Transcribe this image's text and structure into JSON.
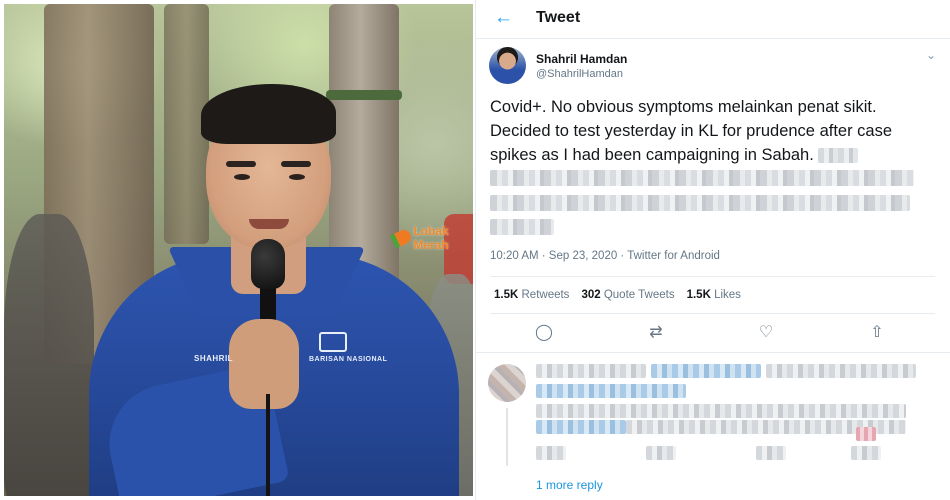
{
  "header": {
    "back_icon": "arrow-left-icon",
    "title": "Tweet"
  },
  "watermark": {
    "text": "Lobak Merah"
  },
  "photo": {
    "shirt_name": "SHAHRIL",
    "shirt_party": "BARISAN NASIONAL"
  },
  "tweet": {
    "author_name": "Shahril Hamdan",
    "author_handle": "@ShahrilHamdan",
    "text_lines": [
      "Covid+. No obvious symptoms melainkan penat sikit.",
      "Decided to test yesterday in KL for prudence after case",
      "spikes as I had been campaigning in Sabah."
    ],
    "timestamp": "10:20 AM · Sep 23, 2020 · Twitter for Android",
    "stats": {
      "retweets_count": "1.5K",
      "retweets_label": "Retweets",
      "quotes_count": "302",
      "quotes_label": "Quote Tweets",
      "likes_count": "1.5K",
      "likes_label": "Likes"
    }
  },
  "actions": {
    "reply": "reply-icon",
    "retweet": "retweet-icon",
    "like": "heart-icon",
    "share": "share-icon"
  },
  "replies": {
    "more_replies_label": "1 more reply"
  },
  "colors": {
    "accent": "#1da1f2",
    "text_primary": "#14171a",
    "text_secondary": "#657786",
    "watermark": "#f08a2c"
  }
}
